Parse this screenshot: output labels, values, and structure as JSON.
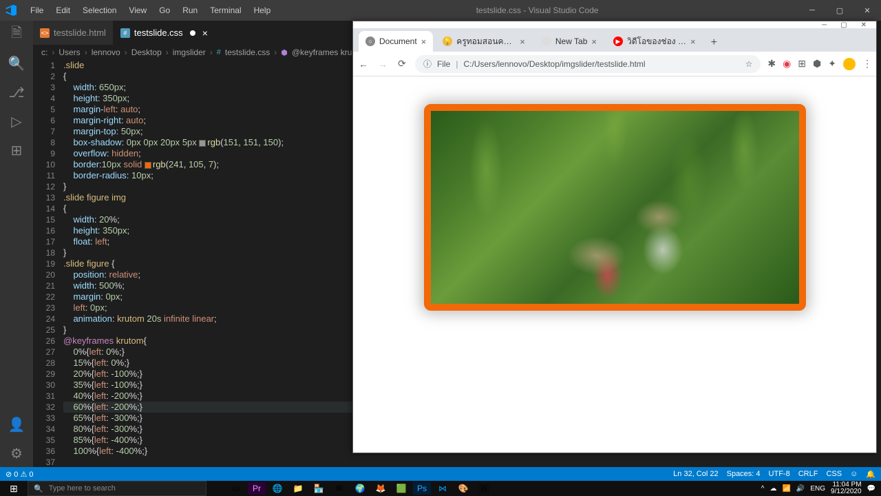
{
  "window": {
    "title": "testslide.css - Visual Studio Code"
  },
  "menu": [
    "File",
    "Edit",
    "Selection",
    "View",
    "Go",
    "Run",
    "Terminal",
    "Help"
  ],
  "tabs": [
    {
      "name": "testslide.html",
      "active": false
    },
    {
      "name": "testslide.css",
      "active": true
    }
  ],
  "breadcrumb": [
    "c:",
    "Users",
    "lennovo",
    "Desktop",
    "imgslider",
    "testslide.css",
    "@keyframes krutom"
  ],
  "code": {
    "lines": [
      ".slide",
      "{",
      "    width: 650px;",
      "    height: 350px;",
      "    margin-left: auto;",
      "    margin-right: auto;",
      "    margin-top: 50px;",
      "    box-shadow: 0px 0px 20px 5px rgb(151, 151, 150);",
      "    overflow: hidden;",
      "    border:10px solid rgb(241, 105, 7);",
      "    border-radius: 10px;",
      "}",
      ".slide figure img",
      "{",
      "    width: 20%;",
      "    height: 350px;",
      "    float: left;",
      "}",
      ".slide figure {",
      "    position: relative;",
      "    width: 500%;",
      "    margin: 0px;",
      "    left: 0px;",
      "    animation: krutom 20s infinite linear;",
      "}",
      "@keyframes krutom{",
      "    0%{left: 0%;}",
      "    15%{left: 0%;}",
      "    20%{left: -100%;}",
      "    35%{left: -100%;}",
      "    40%{left: -200%;}",
      "    60%{left: -200%;}",
      "    65%{left: -300%;}",
      "    80%{left: -300%;}",
      "    85%{left: -400%;}",
      "    100%{left: -400%;}",
      ""
    ],
    "highlight_line": 32
  },
  "status": {
    "left": "⊘ 0 ⚠ 0",
    "lncol": "Ln 32, Col 22",
    "spaces": "Spaces: 4",
    "enc": "UTF-8",
    "eol": "CRLF",
    "lang": "CSS",
    "feedback": "☺"
  },
  "taskbar": {
    "search_placeholder": "Type here to search",
    "time": "11:04 PM",
    "date": "9/12/2020",
    "lang": "ENG"
  },
  "browser": {
    "tabs": [
      {
        "label": "Document",
        "active": true,
        "ico": "🌐"
      },
      {
        "label": "ครูทอมสอนคอมพิวเตอร์",
        "active": false,
        "ico": "💡"
      },
      {
        "label": "New Tab",
        "active": false,
        "ico": ""
      },
      {
        "label": "วิดีโอของช่อง - YouTu",
        "active": false,
        "ico": "▶"
      }
    ],
    "url_prefix": "File",
    "url": "C:/Users/lennovo/Desktop/imgslider/testslide.html"
  }
}
